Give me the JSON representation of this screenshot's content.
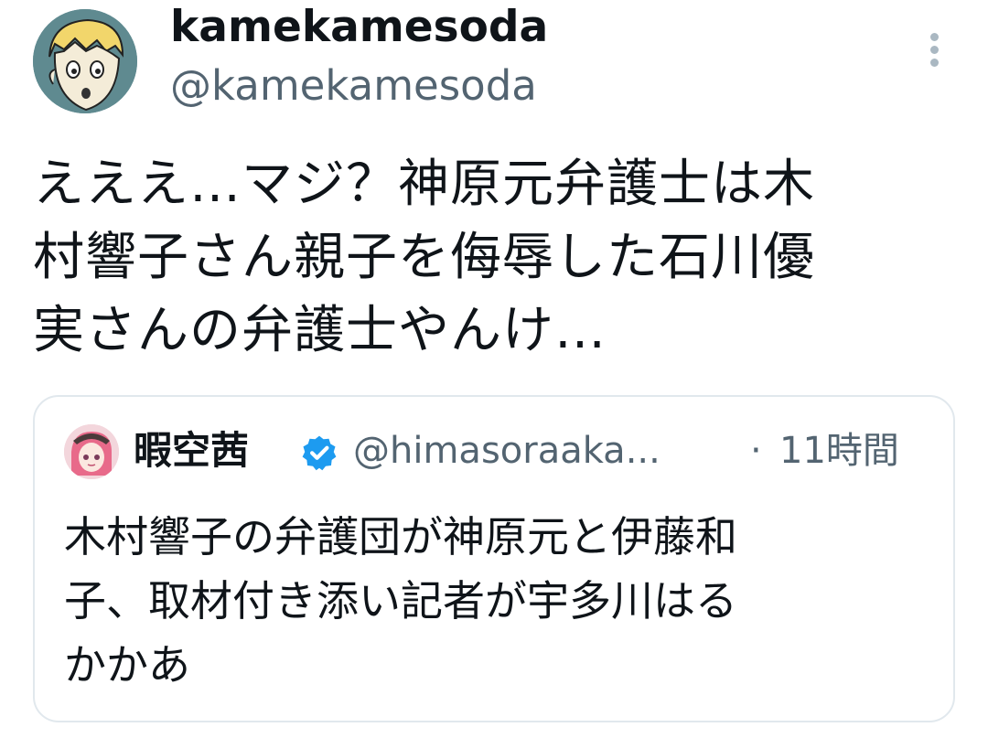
{
  "author": {
    "display_name": "kamekamesoda",
    "handle": "@kamekamesoda",
    "avatar_icon": "cartoon-boy-avatar"
  },
  "more_icon": "more-vertical-icon",
  "tweet": {
    "text_lines": [
      "えええ…マジ？神原元弁護士は木",
      "村響子さん親子を侮辱した石川優",
      "実さんの弁護士やんけ…"
    ]
  },
  "quoted": {
    "display_name": "暇空茜",
    "verified_icon": "verified-badge-icon",
    "handle": "@himasoraaka...",
    "separator": "·",
    "time": "11時間",
    "avatar_icon": "anime-girl-avatar",
    "text_lines": [
      "木村響子の弁護団が神原元と伊藤和",
      "子、取材付き添い記者が宇多川はる",
      "かかあ"
    ]
  },
  "colors": {
    "text": "#0f1419",
    "secondary": "#536471",
    "border": "#e1e8ed",
    "verified": "#1d9bf0"
  }
}
